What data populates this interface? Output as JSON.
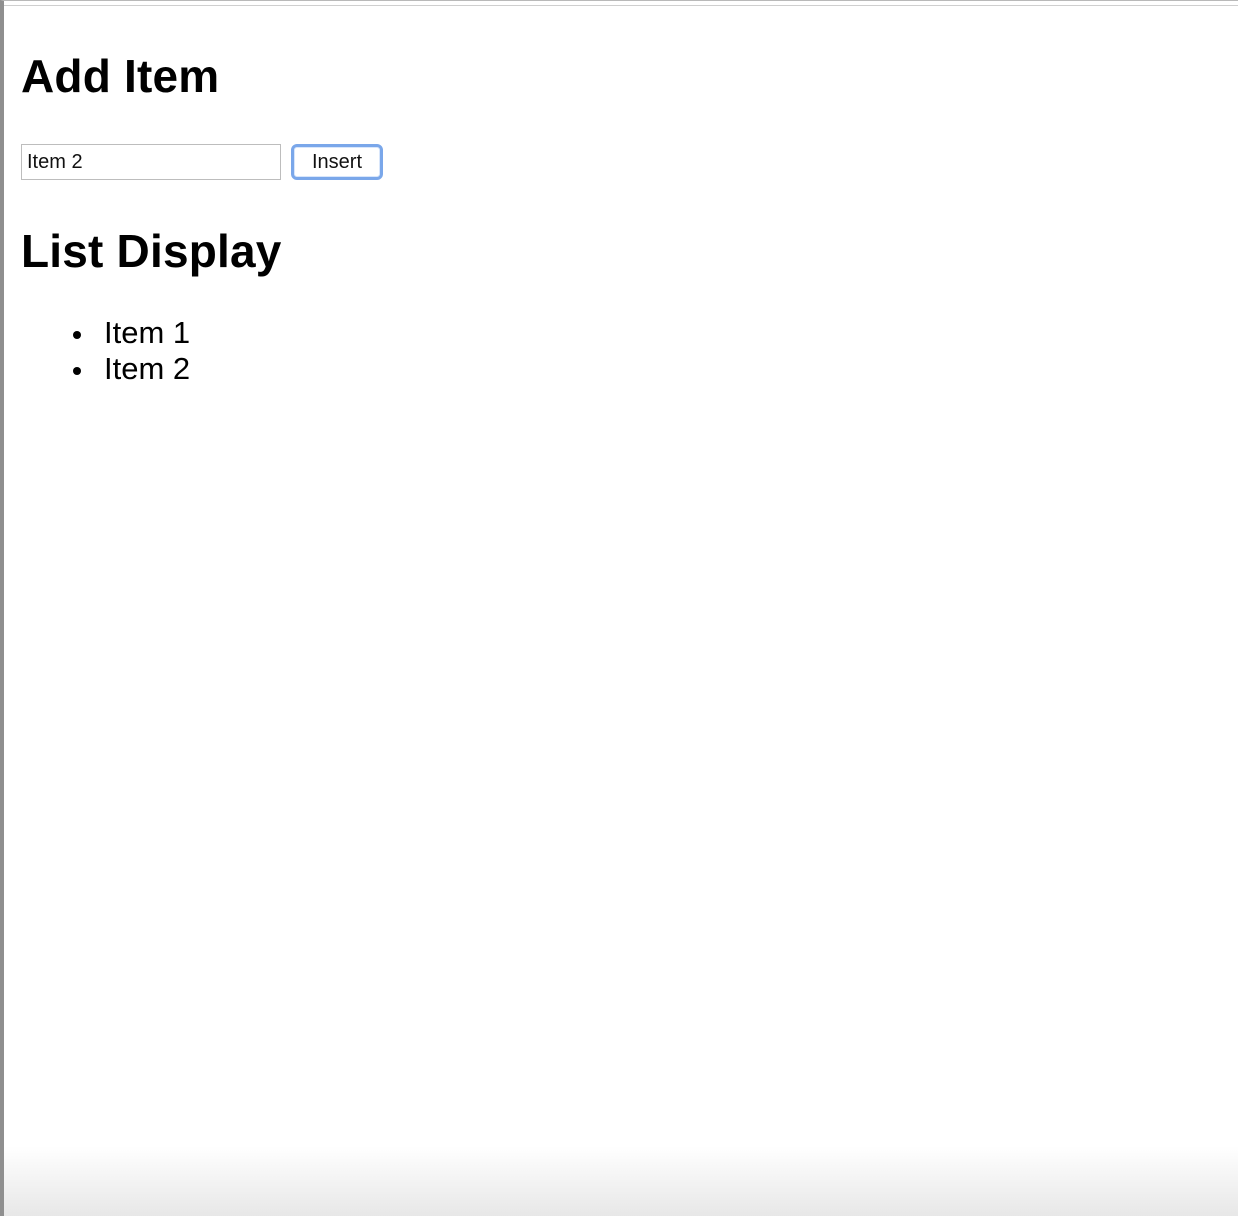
{
  "add_item": {
    "title": "Add Item",
    "input": {
      "value": "Item 2",
      "placeholder": ""
    },
    "insert_button_label": "Insert"
  },
  "list_display": {
    "title": "List Display",
    "items": [
      {
        "label": "Item 1"
      },
      {
        "label": "Item 2"
      }
    ]
  },
  "colors": {
    "focus_ring": "#7aa7ea",
    "input_border": "#bdbdbd",
    "text": "#000000"
  }
}
